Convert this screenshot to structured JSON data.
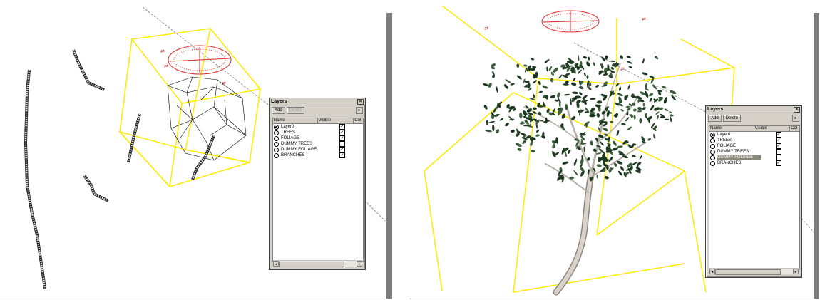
{
  "window_left": {
    "title": "Layers",
    "close_glyph": "×",
    "add_label": "Add",
    "delete_label": "Delete",
    "menu_glyph": "▸",
    "columns": [
      "Name",
      "Visible",
      "Col"
    ],
    "layers": [
      {
        "name": "Layer0",
        "active": true,
        "visible": true,
        "selected": false
      },
      {
        "name": "TREES",
        "active": false,
        "visible": true,
        "selected": false
      },
      {
        "name": "FOLIAGE",
        "active": false,
        "visible": true,
        "selected": false
      },
      {
        "name": "DUMMY TREES",
        "active": false,
        "visible": false,
        "selected": false
      },
      {
        "name": "DUMMY FOLIAGE",
        "active": false,
        "visible": true,
        "selected": false
      },
      {
        "name": "BRANCHES",
        "active": false,
        "visible": true,
        "selected": false
      }
    ]
  },
  "window_right": {
    "title": "Layers",
    "close_glyph": "×",
    "add_label": "Add",
    "delete_label": "Delete",
    "menu_glyph": "▸",
    "columns": [
      "Name",
      "Visible",
      "Col"
    ],
    "layers": [
      {
        "name": "Layer0",
        "active": true,
        "visible": true,
        "selected": false
      },
      {
        "name": "TREES",
        "active": false,
        "visible": true,
        "selected": false
      },
      {
        "name": "FOLIAGE",
        "active": false,
        "visible": true,
        "selected": false
      },
      {
        "name": "DUMMY TREES",
        "active": false,
        "visible": false,
        "selected": false
      },
      {
        "name": "DUMMY FOLIAGE",
        "active": false,
        "visible": false,
        "selected": true
      },
      {
        "name": "BRANCHES",
        "active": false,
        "visible": true,
        "selected": false
      }
    ]
  },
  "icons": {
    "checkbox": "check-icon",
    "radio": "radio-icon",
    "scroll_left": "scroll-left-icon",
    "scroll_right": "scroll-right-icon"
  },
  "colors": {
    "bounding_box": "#ffea00",
    "protractor": "#e0282a",
    "panel_bg": "#d4d0c8",
    "selection": "#8a8878",
    "leaf": "#1e3b22",
    "trunk": "#c9c2b8"
  }
}
